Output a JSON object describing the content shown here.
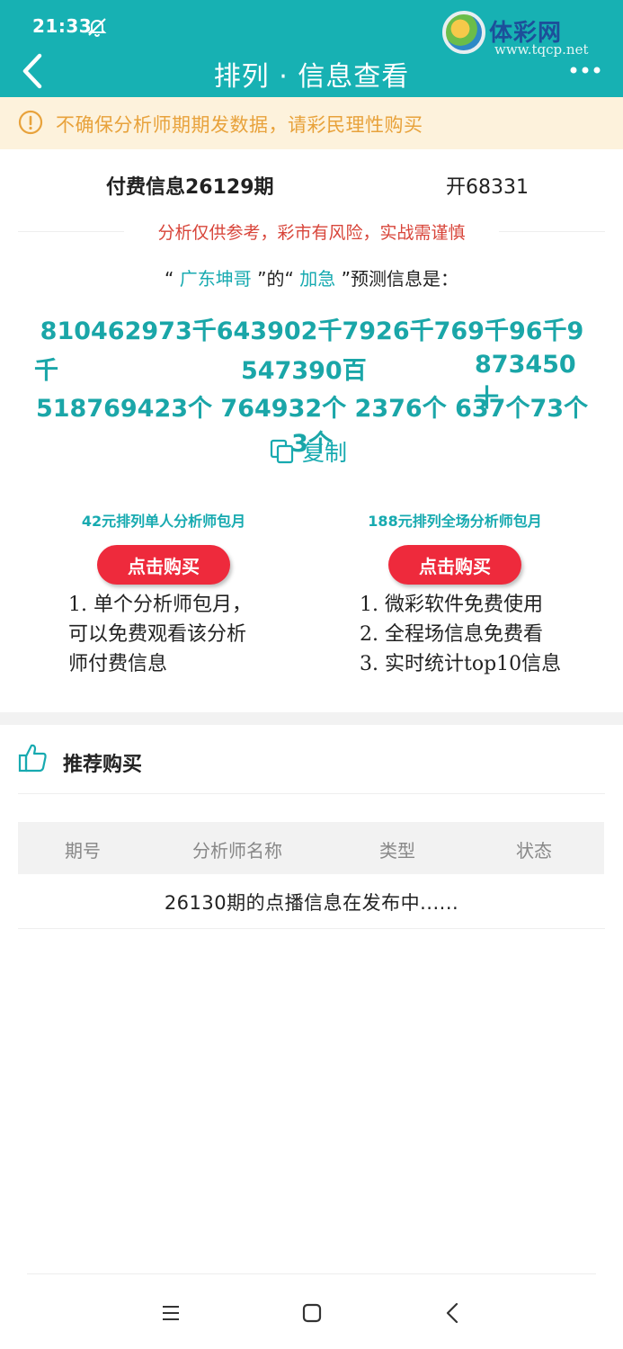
{
  "status_bar": {
    "time": "21:33"
  },
  "header": {
    "title": "排列 · 信息查看"
  },
  "watermark": {
    "text": "体彩网",
    "url": "www.tqcp.net"
  },
  "notice": {
    "text": "不确保分析师期期发数据，请彩民理性购买"
  },
  "issue": {
    "label": "付费信息26129期",
    "result": "开68331"
  },
  "risk": {
    "text": "分析仅供参考，彩市有风险，实战需谨慎"
  },
  "prediction": {
    "open_quote_1": "“",
    "analyst": "广东坤哥",
    "close_quote_1": "”的“",
    "type": "加急",
    "tail": "”预测信息是："
  },
  "numbers": {
    "row1": "810462973千643902千7926千769千96千9",
    "row2": [
      "千",
      "547390百",
      "873450十"
    ],
    "row3": "518769423个 764932个 2376个 637个73个3个"
  },
  "copy": {
    "label": "复制"
  },
  "plans": [
    {
      "title": "42元排列单人分析师包月",
      "button": "点击购买",
      "lines": [
        "1. 单个分析师包月，",
        "可以免费观看该分析",
        "师付费信息"
      ]
    },
    {
      "title": "188元排列全场分析师包月",
      "button": "点击购买",
      "lines": [
        "1. 微彩软件免费使用",
        "2. 全程场信息免费看",
        "3. 实时统计top10信息"
      ]
    }
  ],
  "recommend": {
    "title": "推荐购买",
    "columns": [
      "期号",
      "分析师名称",
      "类型",
      "状态"
    ],
    "empty_text": "26130期的点播信息在发布中......"
  },
  "colors": {
    "accent": "#17b1b3",
    "number_teal": "#1aa6a8",
    "buy_red": "#ee2a3c",
    "notice_orange": "#e8a23b",
    "risk_red": "#d8453a"
  }
}
